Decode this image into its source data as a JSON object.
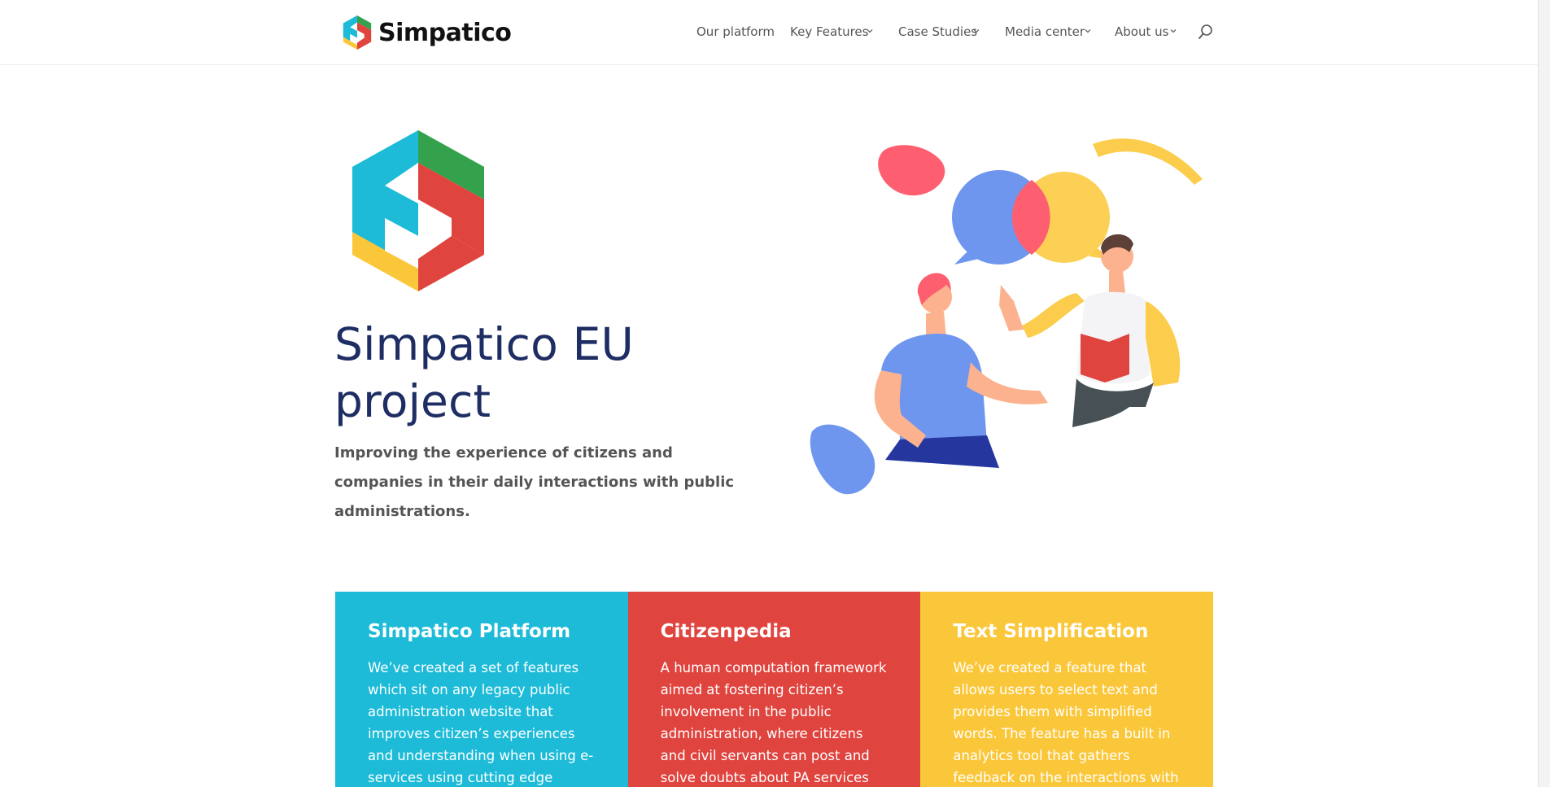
{
  "brand": {
    "name": "Simpatico"
  },
  "nav": {
    "items": [
      {
        "label": "Our platform"
      },
      {
        "label": "Key Features"
      },
      {
        "label": "Case Studies"
      },
      {
        "label": "Media center"
      },
      {
        "label": "About us"
      }
    ],
    "search_icon": "search-icon",
    "dropdown_icon": "chevron-down-icon"
  },
  "hero": {
    "title": "Simpatico EU project",
    "subtitle": "Improving the experience of citizens and companies in their daily interactions with public administrations."
  },
  "cards": [
    {
      "title": "Simpatico Platform",
      "body": "We’ve created a set of features which sit on any legacy public administration website that improves citizen’s experiences and understanding when using e-services using cutting edge technologies.",
      "color": "#1dbbd8"
    },
    {
      "title": "Citizenpedia",
      "body": "A human computation framework aimed at fostering citizen’s involvement in the public administration, where citizens and civil servants can post and solve doubts about PA services and",
      "color": "#e0443f"
    },
    {
      "title": "Text Simplification",
      "body": "We’ve created a feature that allows users to select text and provides them with simplified words. The feature has a built in analytics tool that gathers feedback on the interactions with the e-services.",
      "color": "#fbc73a"
    }
  ],
  "colors": {
    "title": "#1e2d63",
    "logo_green": "#34a24d",
    "logo_cyan": "#1dbbd8",
    "logo_red": "#e0443f",
    "logo_yellow": "#fbc73a"
  }
}
